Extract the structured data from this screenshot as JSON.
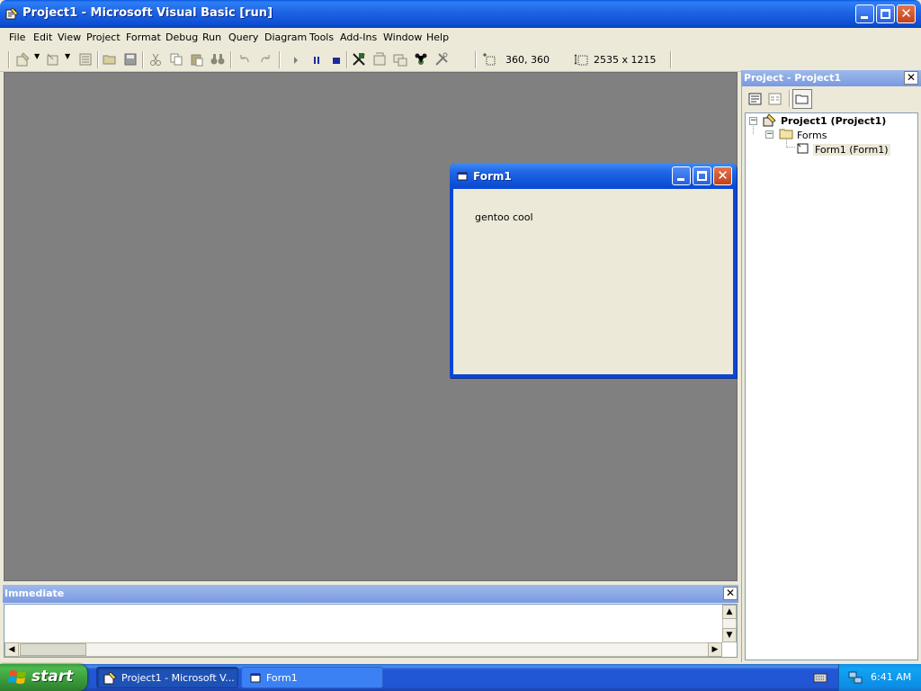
{
  "window": {
    "title": "Project1 - Microsoft Visual Basic [run]"
  },
  "menu": [
    {
      "label": "File"
    },
    {
      "label": "Edit"
    },
    {
      "label": "View"
    },
    {
      "label": "Project"
    },
    {
      "label": "Format"
    },
    {
      "label": "Debug"
    },
    {
      "label": "Run"
    },
    {
      "label": "Query"
    },
    {
      "label": "Diagram"
    },
    {
      "label": "Tools"
    },
    {
      "label": "Add-Ins"
    },
    {
      "label": "Window"
    },
    {
      "label": "Help"
    }
  ],
  "toolbar": {
    "position_readout": "360, 360",
    "size_readout": "2535 x 1215"
  },
  "form1": {
    "title": "Form1",
    "label": "gentoo cool"
  },
  "immediate": {
    "title": "Immediate",
    "close_glyph": "✕"
  },
  "project_explorer": {
    "title": "Project - Project1",
    "close_glyph": "✕",
    "tree": {
      "root": "Project1 (Project1)",
      "folder": "Forms",
      "item": "Form1 (Form1)"
    }
  },
  "taskbar": {
    "start_label": "start",
    "tasks": [
      {
        "label": "Project1 - Microsoft V..."
      },
      {
        "label": "Form1"
      }
    ],
    "clock": "6:41 AM"
  },
  "colors": {
    "title_blue": "#0d4ed3",
    "mdi_gray": "#808080",
    "start_green": "#3a9b3a",
    "pane_header": "#7a9ae0"
  }
}
